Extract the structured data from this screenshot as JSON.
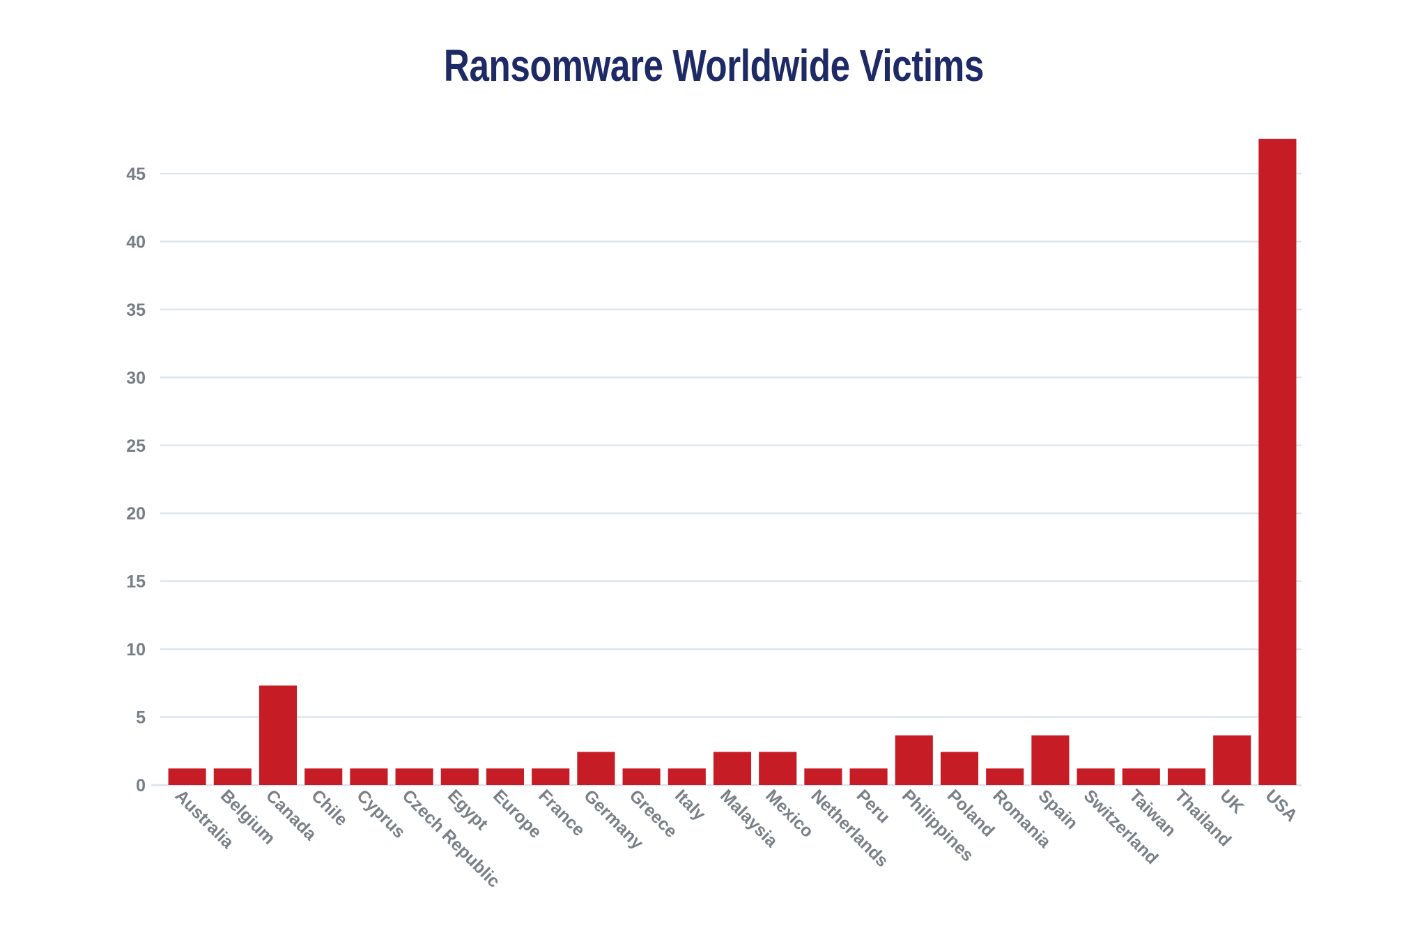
{
  "chart_data": {
    "type": "bar",
    "title": "Ransomware Worldwide Victims",
    "xlabel": "",
    "ylabel": "",
    "ylim": [
      0,
      47.56
    ],
    "yticks": [
      0,
      5,
      10,
      15,
      20,
      25,
      30,
      35,
      40,
      45
    ],
    "grid": true,
    "legend": "none",
    "bar_color": "#C61C26",
    "categories": [
      "Australia",
      "Belgium",
      "Canada",
      "Chile",
      "Cyprus",
      "Czech Republic",
      "Egypt",
      "Europe",
      "France",
      "Germany",
      "Greece",
      "Italy",
      "Malaysia",
      "Mexico",
      "Netherlands",
      "Peru",
      "Philippines",
      "Poland",
      "Romania",
      "Spain",
      "Switzerland",
      "Taiwan",
      "Thailand",
      "UK",
      "USA"
    ],
    "values": [
      1.22,
      1.22,
      7.32,
      1.22,
      1.22,
      1.22,
      1.22,
      1.22,
      1.22,
      2.44,
      1.22,
      1.22,
      2.44,
      2.44,
      1.22,
      1.22,
      3.66,
      2.44,
      1.22,
      3.66,
      1.22,
      1.22,
      1.22,
      3.66,
      47.56
    ]
  },
  "colors": {
    "title": "#1E2A66",
    "bar": "#C61C26",
    "tick_text": "#777E86",
    "gridline": "#DCE4EC"
  }
}
